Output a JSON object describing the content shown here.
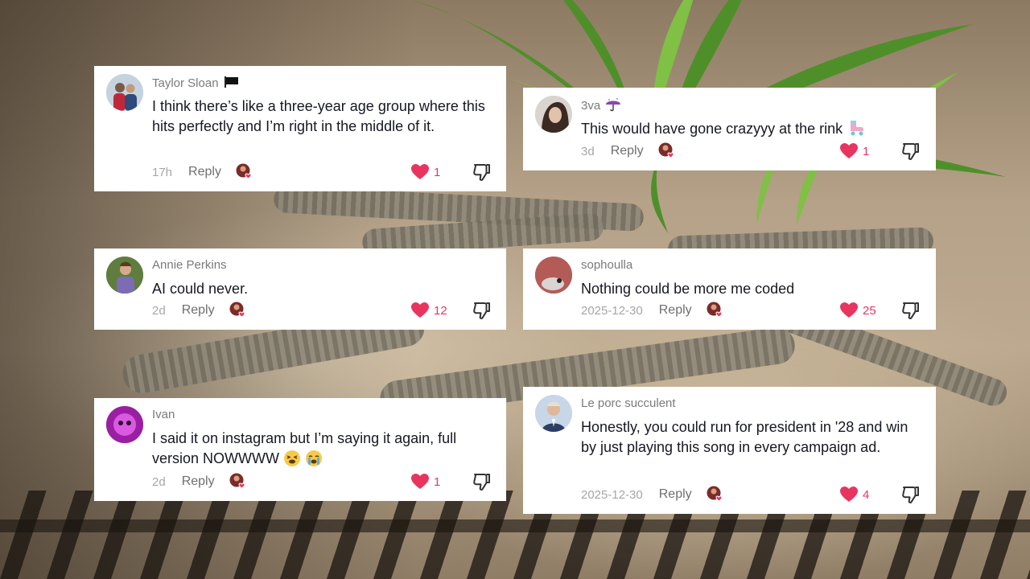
{
  "comments": [
    {
      "username": "Taylor Sloan",
      "username_icon": "black-flag-icon",
      "text": "I think there’s like a three-year age group where this hits perfectly and I’m right in the middle of it.",
      "date": "17h",
      "reply_label": "Reply",
      "likes": "1"
    },
    {
      "username": "3va",
      "username_icon": "umbrella-icon",
      "text": "This would have gone crazyyy at the rink",
      "text_icon": "roller-skate-icon",
      "date": "3d",
      "reply_label": "Reply",
      "likes": "1"
    },
    {
      "username": "Annie Perkins",
      "text": "AI could never.",
      "date": "2d",
      "reply_label": "Reply",
      "likes": "12"
    },
    {
      "username": "sophoulla",
      "text": "Nothing could be more me coded",
      "date": "2025-12-30",
      "reply_label": "Reply",
      "likes": "25"
    },
    {
      "username": "Ivan",
      "text": "I said it on instagram but I’m saying it again, full version NOWWWW",
      "text_icons": [
        "tired-face-emoji-icon",
        "crying-face-emoji-icon"
      ],
      "date": "2d",
      "reply_label": "Reply",
      "likes": "1"
    },
    {
      "username": "Le porc succulent",
      "text": "Honestly, you could run for president in '28 and win by just playing this song in every campaign ad.",
      "date": "2025-12-30",
      "reply_label": "Reply",
      "likes": "4"
    }
  ],
  "colors": {
    "like_red": "#e8355f",
    "card_bg": "#ffffff",
    "text": "#161823",
    "muted": "#a6a6a6"
  }
}
